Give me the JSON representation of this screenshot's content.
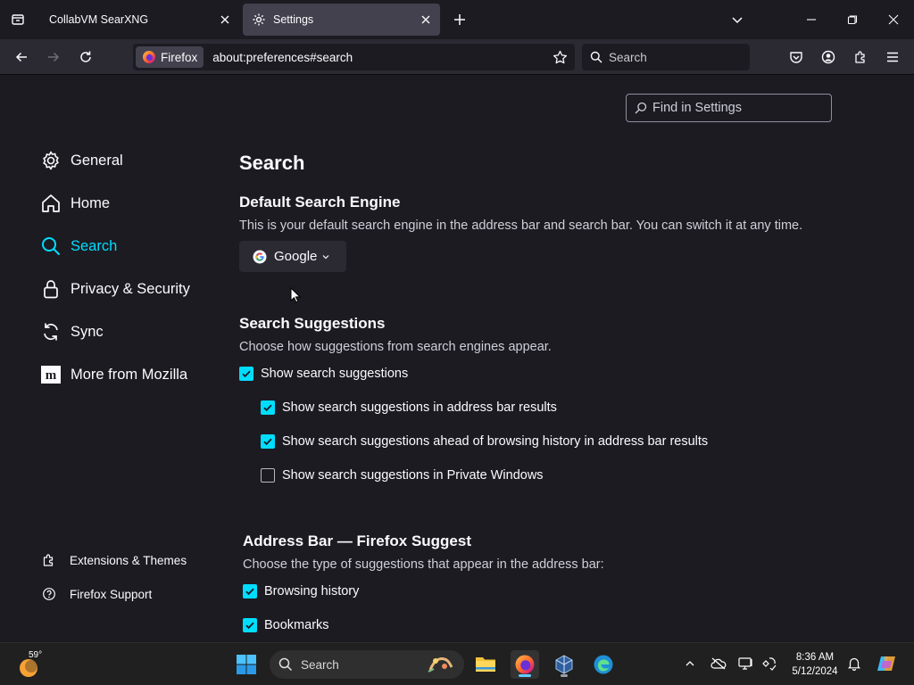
{
  "tabs": [
    {
      "title": "CollabVM SearXNG",
      "active": false
    },
    {
      "title": "Settings",
      "active": true
    }
  ],
  "navbar": {
    "identity_label": "Firefox",
    "url": "about:preferences#search",
    "search_placeholder": "Search"
  },
  "find": {
    "placeholder": "Find in Settings"
  },
  "sidebar": {
    "items": [
      {
        "label": "General",
        "icon": "gear-icon"
      },
      {
        "label": "Home",
        "icon": "home-icon"
      },
      {
        "label": "Search",
        "icon": "search-icon",
        "selected": true
      },
      {
        "label": "Privacy & Security",
        "icon": "lock-icon"
      },
      {
        "label": "Sync",
        "icon": "sync-icon"
      },
      {
        "label": "More from Mozilla",
        "icon": "mozilla-icon"
      }
    ],
    "footer": [
      {
        "label": "Extensions & Themes",
        "icon": "puzzle-icon"
      },
      {
        "label": "Firefox Support",
        "icon": "help-icon"
      }
    ]
  },
  "main": {
    "title": "Search",
    "default_engine": {
      "heading": "Default Search Engine",
      "description": "This is your default search engine in the address bar and search bar. You can switch it at any time.",
      "selected": "Google"
    },
    "suggestions": {
      "heading": "Search Suggestions",
      "description": "Choose how suggestions from search engines appear.",
      "options": [
        {
          "label": "Show search suggestions",
          "checked": true
        },
        {
          "label": "Show search suggestions in address bar results",
          "checked": true
        },
        {
          "label": "Show search suggestions ahead of browsing history in address bar results",
          "checked": true
        },
        {
          "label": "Show search suggestions in Private Windows",
          "checked": false
        }
      ]
    },
    "address_bar": {
      "heading": "Address Bar — Firefox Suggest",
      "description": "Choose the type of suggestions that appear in the address bar:",
      "options": [
        {
          "label": "Browsing history",
          "checked": true
        },
        {
          "label": "Bookmarks",
          "checked": true
        }
      ]
    }
  },
  "taskbar": {
    "weather_temp": "59°",
    "search_placeholder": "Search",
    "time": "8:36 AM",
    "date": "5/12/2024"
  },
  "colors": {
    "accent": "#00ddff",
    "background": "#1c1b22",
    "toolbar": "#2b2a33"
  }
}
